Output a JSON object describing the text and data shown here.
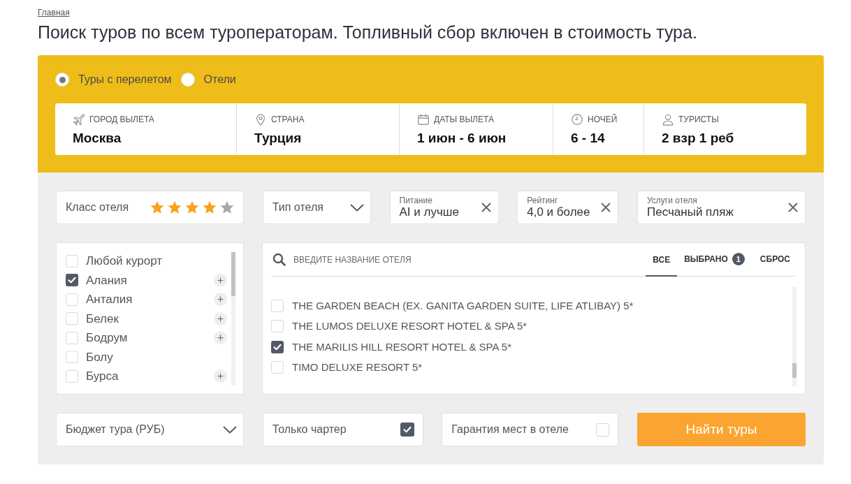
{
  "breadcrumb": "Главная",
  "title": "Поиск туров по всем туроператорам. Топливный сбор включен в стоимость тура.",
  "search": {
    "modes": [
      {
        "label": "Туры с перелетом",
        "selected": true
      },
      {
        "label": "Отели",
        "selected": false
      }
    ],
    "fields": [
      {
        "kind": "plane",
        "label": "ГОРОД ВЫЛЕТА",
        "value": "Москва"
      },
      {
        "kind": "pin",
        "label": "СТРАНА",
        "value": "Турция"
      },
      {
        "kind": "calendar",
        "label": "ДАТЫ ВЫЛЕТА",
        "value": "1 июн - 6 июн"
      },
      {
        "kind": "clock",
        "label": "НОЧЕЙ",
        "value": "6 - 14"
      },
      {
        "kind": "person",
        "label": "ТУРИСТЫ",
        "value": "2 взр 1 реб"
      }
    ]
  },
  "filters": {
    "hotel_class": {
      "label": "Класс отеля",
      "stars": 4
    },
    "hotel_type": {
      "label": "Тип отеля"
    },
    "chips": [
      {
        "label": "Питание",
        "value": "AI и лучше"
      },
      {
        "label": "Рейтинг",
        "value": "4,0 и более"
      },
      {
        "label": "Услуги отеля",
        "value": "Песчаный пляж"
      }
    ]
  },
  "resorts": [
    {
      "label": "Любой курорт",
      "checked": false,
      "expandable": false
    },
    {
      "label": "Алания",
      "checked": true,
      "expandable": true
    },
    {
      "label": "Анталия",
      "checked": false,
      "expandable": true
    },
    {
      "label": "Белек",
      "checked": false,
      "expandable": true
    },
    {
      "label": "Бодрум",
      "checked": false,
      "expandable": true
    },
    {
      "label": "Болу",
      "checked": false,
      "expandable": false
    },
    {
      "label": "Бурса",
      "checked": false,
      "expandable": true
    }
  ],
  "hotels": {
    "placeholder": "ВВЕДИТЕ НАЗВАНИЕ ОТЕЛЯ",
    "tabs": [
      {
        "label": "ВСЕ",
        "selected": true
      },
      {
        "label": "ВЫБРАНО",
        "selected": false,
        "count": "1"
      }
    ],
    "reset": "СБРОС",
    "items": [
      {
        "label": "THE GARDEN BEACH (EX. GANITA GARDEN SUITE, LIFE ATLIBAY) 5*",
        "checked": false
      },
      {
        "label": "THE LUMOS DELUXE RESORT HOTEL & SPA 5*",
        "checked": false
      },
      {
        "label": "THE MARILIS HILL RESORT HOTEL & SPA 5*",
        "checked": true
      },
      {
        "label": "TIMO DELUXE RESORT 5*",
        "checked": false
      }
    ]
  },
  "budget": {
    "label": "Бюджет тура (РУБ)"
  },
  "options": [
    {
      "label": "Только чартер",
      "checked": true
    },
    {
      "label": "Гарантия мест в отеле",
      "checked": false
    }
  ],
  "submit": "Найти туры"
}
